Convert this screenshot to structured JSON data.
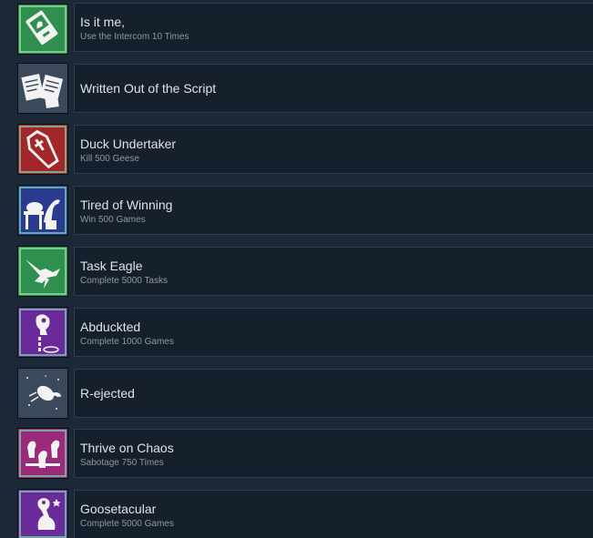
{
  "achievements": [
    {
      "title": "Is it me,",
      "description": "Use the Intercom 10 Times",
      "icon": "intercom-icon",
      "color": "#2f8f4e"
    },
    {
      "title": "Written Out of the Script",
      "description": "",
      "icon": "script-pages-icon",
      "color": "#3a4a5c"
    },
    {
      "title": "Duck Undertaker",
      "description": "Kill 500 Geese",
      "icon": "coffin-icon",
      "color": "#a3262b"
    },
    {
      "title": "Tired of Winning",
      "description": "Win 500 Games",
      "icon": "tired-goose-icon",
      "color": "#2a3b8f"
    },
    {
      "title": "Task Eagle",
      "description": "Complete 5000 Tasks",
      "icon": "eagle-icon",
      "color": "#2f8f4e"
    },
    {
      "title": "Abduckted",
      "description": "Complete 1000 Games",
      "icon": "ufo-goose-icon",
      "color": "#6a2a9a"
    },
    {
      "title": "R-ejected",
      "description": "",
      "icon": "ejected-goose-icon",
      "color": "#3a4a5c"
    },
    {
      "title": "Thrive on Chaos",
      "description": "Sabotage 750 Times",
      "icon": "chaos-geese-icon",
      "color": "#9a2a7a"
    },
    {
      "title": "Goosetacular",
      "description": "Complete 5000 Games",
      "icon": "goose-star-icon",
      "color": "#6a2a9a"
    }
  ]
}
